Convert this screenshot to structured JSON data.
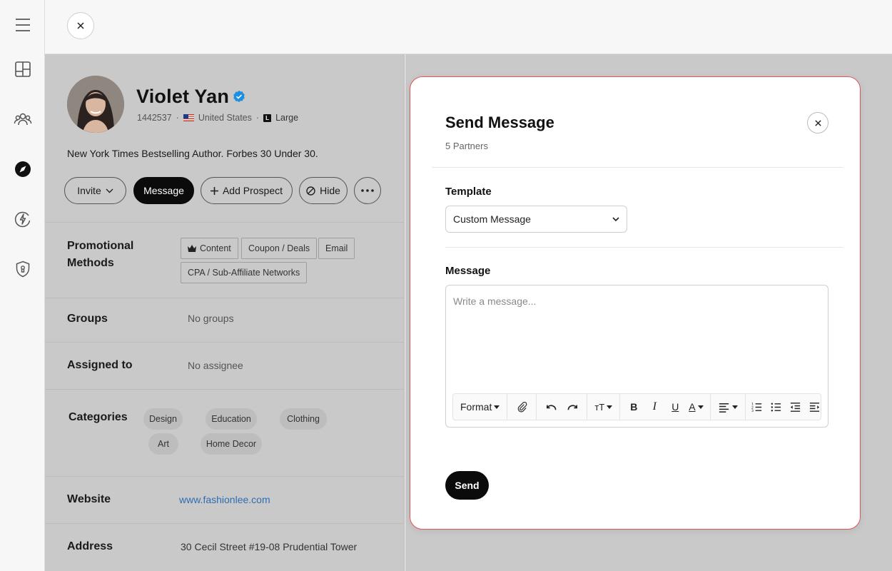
{
  "sidebar": {
    "items": [
      {
        "icon": "menu-icon"
      },
      {
        "icon": "dashboard-icon"
      },
      {
        "icon": "partners-icon"
      },
      {
        "icon": "discover-compass-icon"
      },
      {
        "icon": "automation-bolt-icon"
      },
      {
        "icon": "security-shield-icon"
      }
    ]
  },
  "profile": {
    "name": "Violet Yan",
    "id": "1442537",
    "country": "United States",
    "size_badge": "L",
    "size": "Large",
    "bio": "New York Times Bestselling Author. Forbes 30 Under 30.",
    "actions": {
      "invite": "Invite",
      "message": "Message",
      "add_prospect": "Add Prospect",
      "hide": "Hide"
    },
    "promotional_methods": {
      "label": "Promotional Methods",
      "items": [
        "Content",
        "Coupon / Deals",
        "Email",
        "CPA / Sub-Affiliate Networks"
      ]
    },
    "groups": {
      "label": "Groups",
      "value": "No groups"
    },
    "assigned": {
      "label": "Assigned to",
      "value": "No assignee"
    },
    "categories": {
      "label": "Categories",
      "items": [
        "Design",
        "Education",
        "Clothing",
        "Art",
        "Home Decor"
      ]
    },
    "website": {
      "label": "Website",
      "value": "www.fashionlee.com"
    },
    "address": {
      "label": "Address",
      "value": "30 Cecil Street #19-08 Prudential Tower"
    }
  },
  "modal": {
    "title": "Send Message",
    "subtitle": "5 Partners",
    "template_label": "Template",
    "template_value": "Custom Message",
    "message_label": "Message",
    "message_placeholder": "Write a message...",
    "toolbar": {
      "format": "Format",
      "bold": "B",
      "italic": "I",
      "underline": "U",
      "font_color": "A",
      "font_size": "тT"
    },
    "send_label": "Send"
  },
  "colors": {
    "accent_dark": "#0b0b0b",
    "link": "#2f6db3",
    "verified": "#1d8fe0",
    "modal_border": "#e35656"
  }
}
